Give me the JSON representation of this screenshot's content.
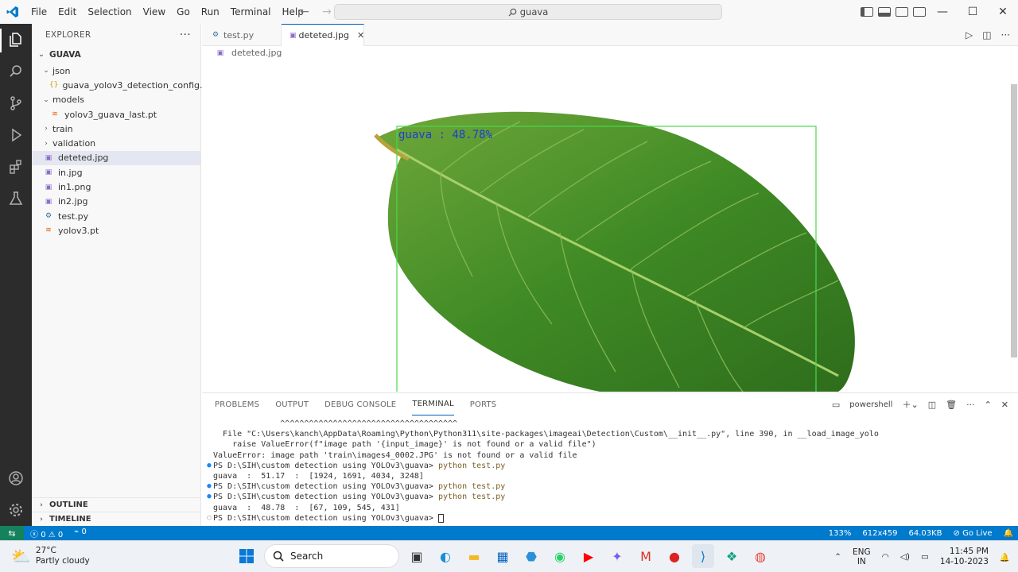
{
  "menu": [
    "File",
    "Edit",
    "Selection",
    "View",
    "Go",
    "Run",
    "Terminal",
    "Help"
  ],
  "search": {
    "text": "guava"
  },
  "sidebar": {
    "title": "EXPLORER",
    "folder": "GUAVA",
    "items": [
      {
        "label": "json",
        "type": "folder-open",
        "depth": 1
      },
      {
        "label": "guava_yolov3_detection_config.json",
        "type": "json",
        "depth": 2
      },
      {
        "label": "models",
        "type": "folder-open",
        "depth": 1
      },
      {
        "label": "yolov3_guava_last.pt",
        "type": "pt",
        "depth": 2
      },
      {
        "label": "train",
        "type": "folder",
        "depth": 1
      },
      {
        "label": "validation",
        "type": "folder",
        "depth": 1
      },
      {
        "label": "deteted.jpg",
        "type": "img",
        "depth": 1,
        "selected": true
      },
      {
        "label": "in.jpg",
        "type": "img",
        "depth": 1
      },
      {
        "label": "in1.png",
        "type": "img",
        "depth": 1
      },
      {
        "label": "in2.jpg",
        "type": "img",
        "depth": 1
      },
      {
        "label": "test.py",
        "type": "py",
        "depth": 1
      },
      {
        "label": "yolov3.pt",
        "type": "pt",
        "depth": 1
      }
    ],
    "outline": "OUTLINE",
    "timeline": "TIMELINE"
  },
  "tabs": [
    {
      "label": "test.py",
      "active": false
    },
    {
      "label": "deteted.jpg",
      "active": true
    }
  ],
  "breadcrumb": "deteted.jpg",
  "viewer": {
    "detection_label": "guava : 48.78%"
  },
  "panel": {
    "tabs": [
      "PROBLEMS",
      "OUTPUT",
      "DEBUG CONSOLE",
      "TERMINAL",
      "PORTS"
    ],
    "active_tab": "TERMINAL",
    "shell": "powershell",
    "lines": [
      {
        "dot": "",
        "text": "              ^^^^^^^^^^^^^^^^^^^^^^^^^^^^^^^^^^^^^"
      },
      {
        "dot": "",
        "text": "  File \"C:\\Users\\kanch\\AppData\\Roaming\\Python\\Python311\\site-packages\\imageai\\Detection\\Custom\\__init__.py\", line 390, in __load_image_yolo"
      },
      {
        "dot": "",
        "text": "    raise ValueError(f\"image path '{input_image}' is not found or a valid file\")"
      },
      {
        "dot": "",
        "text": "ValueError: image path 'train\\images4_0002.JPG' is not found or a valid file"
      },
      {
        "dot": "blue",
        "text": "PS D:\\SIH\\custom detection using YOLOv3\\guava> ",
        "cmd": "python test.py"
      },
      {
        "dot": "",
        "text": "guava  :  51.17  :  [1924, 1691, 4034, 3248]"
      },
      {
        "dot": "blue",
        "text": "PS D:\\SIH\\custom detection using YOLOv3\\guava> ",
        "cmd": "python test.py"
      },
      {
        "dot": "blue",
        "text": "PS D:\\SIH\\custom detection using YOLOv3\\guava> ",
        "cmd": "python test.py"
      },
      {
        "dot": "",
        "text": "guava  :  48.78  :  [67, 109, 545, 431]"
      },
      {
        "dot": "grey",
        "text": "PS D:\\SIH\\custom detection using YOLOv3\\guava> ",
        "cursor": true
      }
    ]
  },
  "status": {
    "errors": "0",
    "warnings": "0",
    "ports": "0",
    "zoom": "133%",
    "dimensions": "612x459",
    "size": "64.03KB",
    "golive": "Go Live"
  },
  "taskbar": {
    "temp": "27°C",
    "weather": "Partly cloudy",
    "search": "Search",
    "lang1": "ENG",
    "lang2": "IN",
    "time": "11:45 PM",
    "date": "14-10-2023"
  },
  "colors": {
    "statusbar": "#007acc",
    "activitybar": "#2c2c2c",
    "box": "#49d84a",
    "label": "#1a3fd1"
  }
}
